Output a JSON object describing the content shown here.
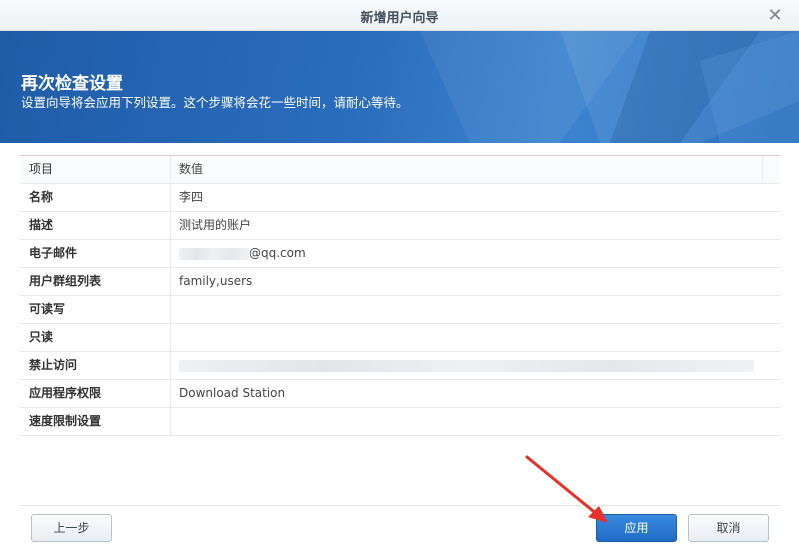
{
  "window": {
    "title": "新增用户向导",
    "close_icon": "close-icon"
  },
  "banner": {
    "heading": "再次检查设置",
    "subtitle": "设置向导将会应用下列设置。这个步骤将会花一些时间，请耐心等待。"
  },
  "table": {
    "columns": [
      "项目",
      "数值"
    ],
    "rows": [
      {
        "item": "名称",
        "value": "李四"
      },
      {
        "item": "描述",
        "value": "测试用的账户"
      },
      {
        "item": "电子邮件",
        "value": "@qq.com",
        "redacted_prefix": true
      },
      {
        "item": "用户群组列表",
        "value": "family,users"
      },
      {
        "item": "可读写",
        "value": ""
      },
      {
        "item": "只读",
        "value": ""
      },
      {
        "item": "禁止访问",
        "value": "",
        "redacted": true
      },
      {
        "item": "应用程序权限",
        "value": "Download Station"
      },
      {
        "item": "速度限制设置",
        "value": ""
      }
    ]
  },
  "footer": {
    "back_label": "上一步",
    "apply_label": "应用",
    "cancel_label": "取消"
  },
  "colors": {
    "banner": "#2a6dbd",
    "apply_button": "#2675d3",
    "annotation_arrow": "#e8302a"
  }
}
